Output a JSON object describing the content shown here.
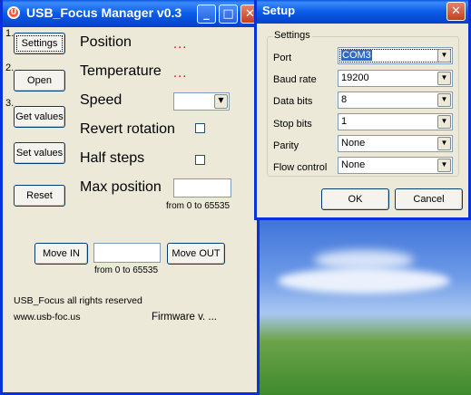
{
  "main_window": {
    "title": "USB_Focus Manager v0.3",
    "steps": [
      "1.",
      "2.",
      "3."
    ],
    "buttons": {
      "settings": "Settings",
      "open": "Open",
      "get_values": "Get values",
      "set_values": "Set values",
      "reset": "Reset",
      "move_in": "Move IN",
      "move_out": "Move OUT"
    },
    "labels": {
      "position": "Position",
      "position_value": "...",
      "temperature": "Temperature",
      "temperature_value": "...",
      "speed": "Speed",
      "revert_rotation": "Revert rotation",
      "half_steps": "Half steps",
      "max_position": "Max position",
      "max_position_range": "from 0 to 65535",
      "move_range": "from 0 to 65535",
      "copyright": "USB_Focus all rights reserved",
      "website": "www.usb-foc.us",
      "firmware": "Firmware v. ..."
    },
    "speed_value": "",
    "max_position_value": "",
    "move_value": "",
    "revert_rotation_checked": false,
    "half_steps_checked": false
  },
  "setup_dialog": {
    "title": "Setup",
    "group_title": "Settings",
    "fields": [
      {
        "label": "Port",
        "value": "COM3"
      },
      {
        "label": "Baud rate",
        "value": "19200"
      },
      {
        "label": "Data bits",
        "value": "8"
      },
      {
        "label": "Stop bits",
        "value": "1"
      },
      {
        "label": "Parity",
        "value": "None"
      },
      {
        "label": "Flow control",
        "value": "None"
      }
    ],
    "ok_label": "OK",
    "cancel_label": "Cancel"
  },
  "colors": {
    "titlebar": "#0a5ce8",
    "window_bg": "#ece9d8",
    "dots": "#e00000",
    "selection": "#316ac5"
  }
}
